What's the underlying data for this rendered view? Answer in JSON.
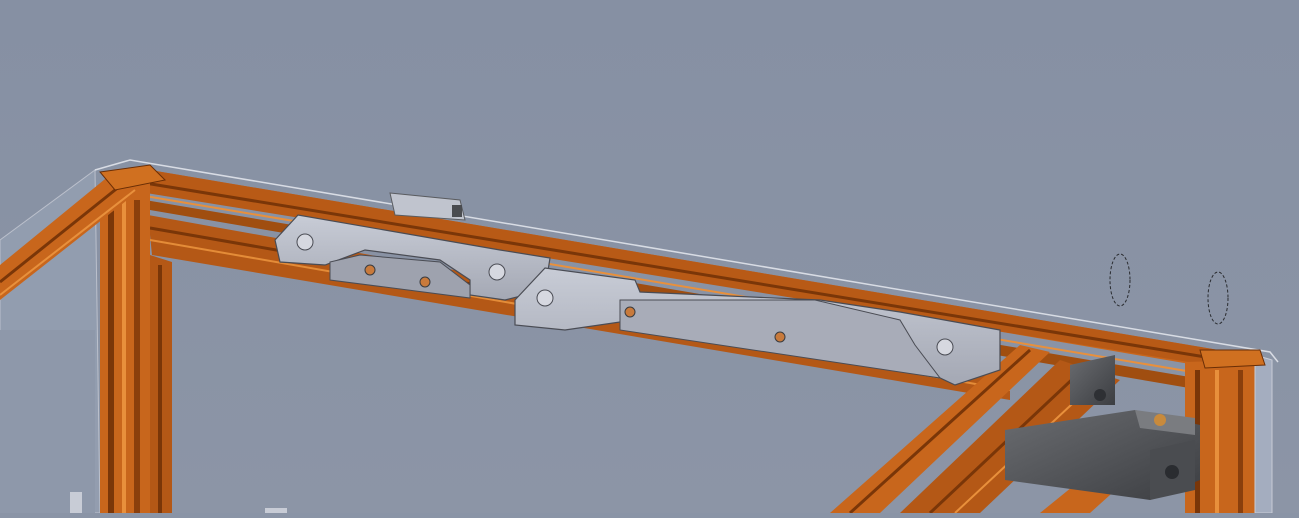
{
  "scene": {
    "background_color": "#8a94a6",
    "glass_panel_color": "#96a0b2",
    "extrusion_color": "#c8661c",
    "extrusion_dark": "#8a3f0c",
    "extrusion_light": "#e8903c",
    "part_grey": "#b4b8c4",
    "part_dark_grey": "#5a5c60",
    "labels": []
  }
}
